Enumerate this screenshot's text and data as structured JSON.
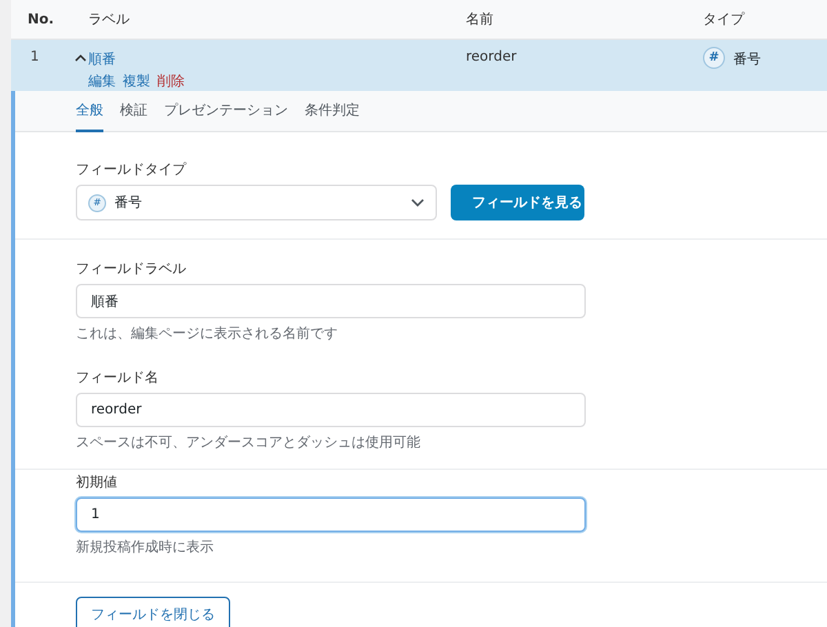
{
  "table": {
    "columns": [
      "No.",
      "ラベル",
      "名前",
      "タイプ"
    ],
    "row": {
      "number": "1",
      "expanded": true,
      "label": "順番",
      "actions": [
        {
          "label": "編集",
          "kind": "normal"
        },
        {
          "label": "複製",
          "kind": "normal"
        },
        {
          "label": "削除",
          "kind": "danger"
        }
      ],
      "name": "reorder",
      "type": "番号",
      "type_icon": "#"
    }
  },
  "tabs": [
    {
      "label": "全般",
      "selected": true
    },
    {
      "label": "検証",
      "selected": false
    },
    {
      "label": "プレゼンテーション",
      "selected": false
    },
    {
      "label": "条件判定",
      "selected": false
    }
  ],
  "sections": [
    {
      "kind": "type",
      "label": "フィールドタイプ",
      "value": "番号",
      "icon": "#",
      "button": "フィールドを見る"
    },
    {
      "kind": "fields",
      "fields": [
        {
          "label": "フィールドラベル",
          "value": "順番",
          "help": "これは、編集ページに表示される名前です",
          "focused": false
        },
        {
          "label": "フィールド名",
          "value": "reorder",
          "help": "スペースは不可、アンダースコアとダッシュは使用可能",
          "focused": false
        }
      ]
    },
    {
      "kind": "fields",
      "fields": [
        {
          "label": "初期値",
          "value": "1",
          "help": "新規投稿作成時に表示",
          "focused": true
        }
      ]
    },
    {
      "kind": "footer",
      "button": "フィールドを閉じる"
    }
  ]
}
